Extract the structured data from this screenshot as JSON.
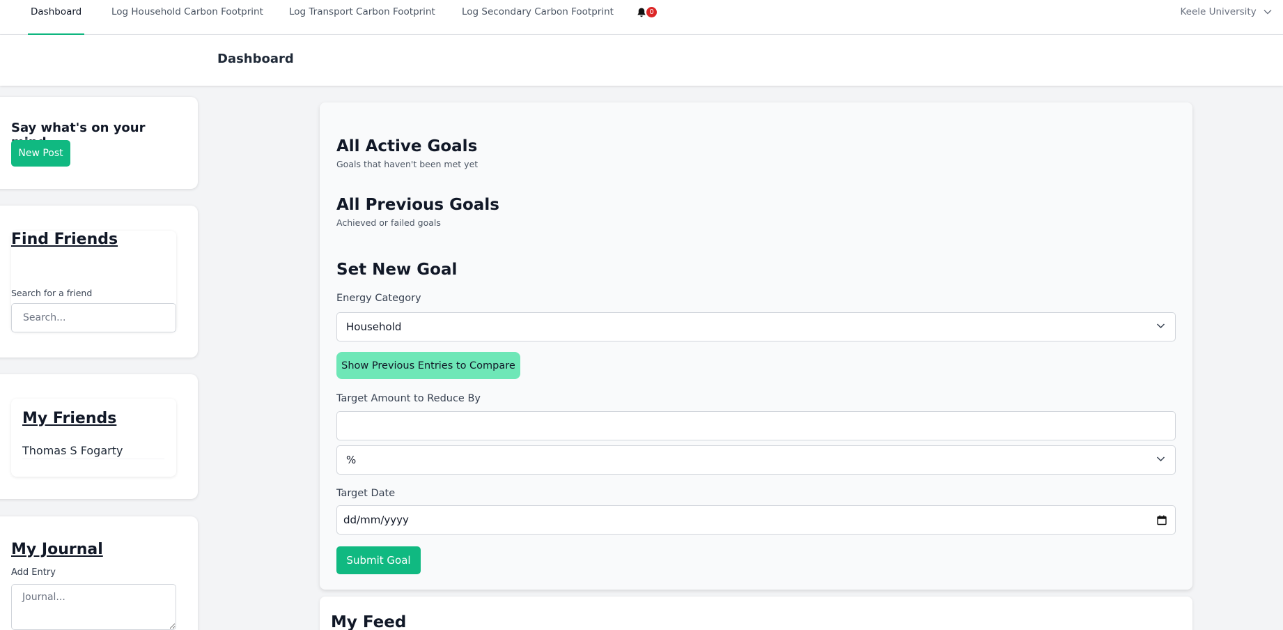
{
  "nav": {
    "items": [
      {
        "label": "Dashboard",
        "active": true
      },
      {
        "label": "Log Household Carbon Footprint",
        "active": false
      },
      {
        "label": "Log Transport Carbon Footprint",
        "active": false
      },
      {
        "label": "Log Secondary Carbon Footprint",
        "active": false
      }
    ],
    "notification_count": "0",
    "user": "Keele University",
    "icons": {
      "notifications": "bell-icon",
      "user_menu": "chevron-down-icon"
    },
    "accent_color": "#10b981",
    "badge_color": "#dc2626"
  },
  "header": {
    "title": "Dashboard"
  },
  "post_card": {
    "title": "Say what's on your mind...",
    "button_label": "New Post"
  },
  "find_friends": {
    "title": "Find Friends",
    "label": "Search for a friend",
    "placeholder": "Search..."
  },
  "my_friends": {
    "title": "My Friends",
    "friends": [
      "Thomas S Fogarty"
    ]
  },
  "journal": {
    "title": "My Journal",
    "label": "Add Entry",
    "placeholder": "Journal..."
  },
  "goals": {
    "active_title": "All Active Goals",
    "active_subtitle": "Goals that haven't been met yet",
    "previous_title": "All Previous Goals",
    "previous_subtitle": "Achieved or failed goals",
    "new_goal_title": "Set New Goal",
    "energy_category_label": "Energy Category",
    "energy_category_value": "Household",
    "compare_button_label": "Show Previous Entries to Compare",
    "target_amount_label": "Target Amount to Reduce By",
    "target_amount_value": "",
    "unit_value": "%",
    "target_date_label": "Target Date",
    "target_date_placeholder": "dd/mm/yyyy",
    "submit_label": "Submit Goal",
    "icons": {
      "select": "chevron-down-icon",
      "date": "calendar-icon"
    }
  },
  "feed": {
    "title": "My Feed"
  }
}
